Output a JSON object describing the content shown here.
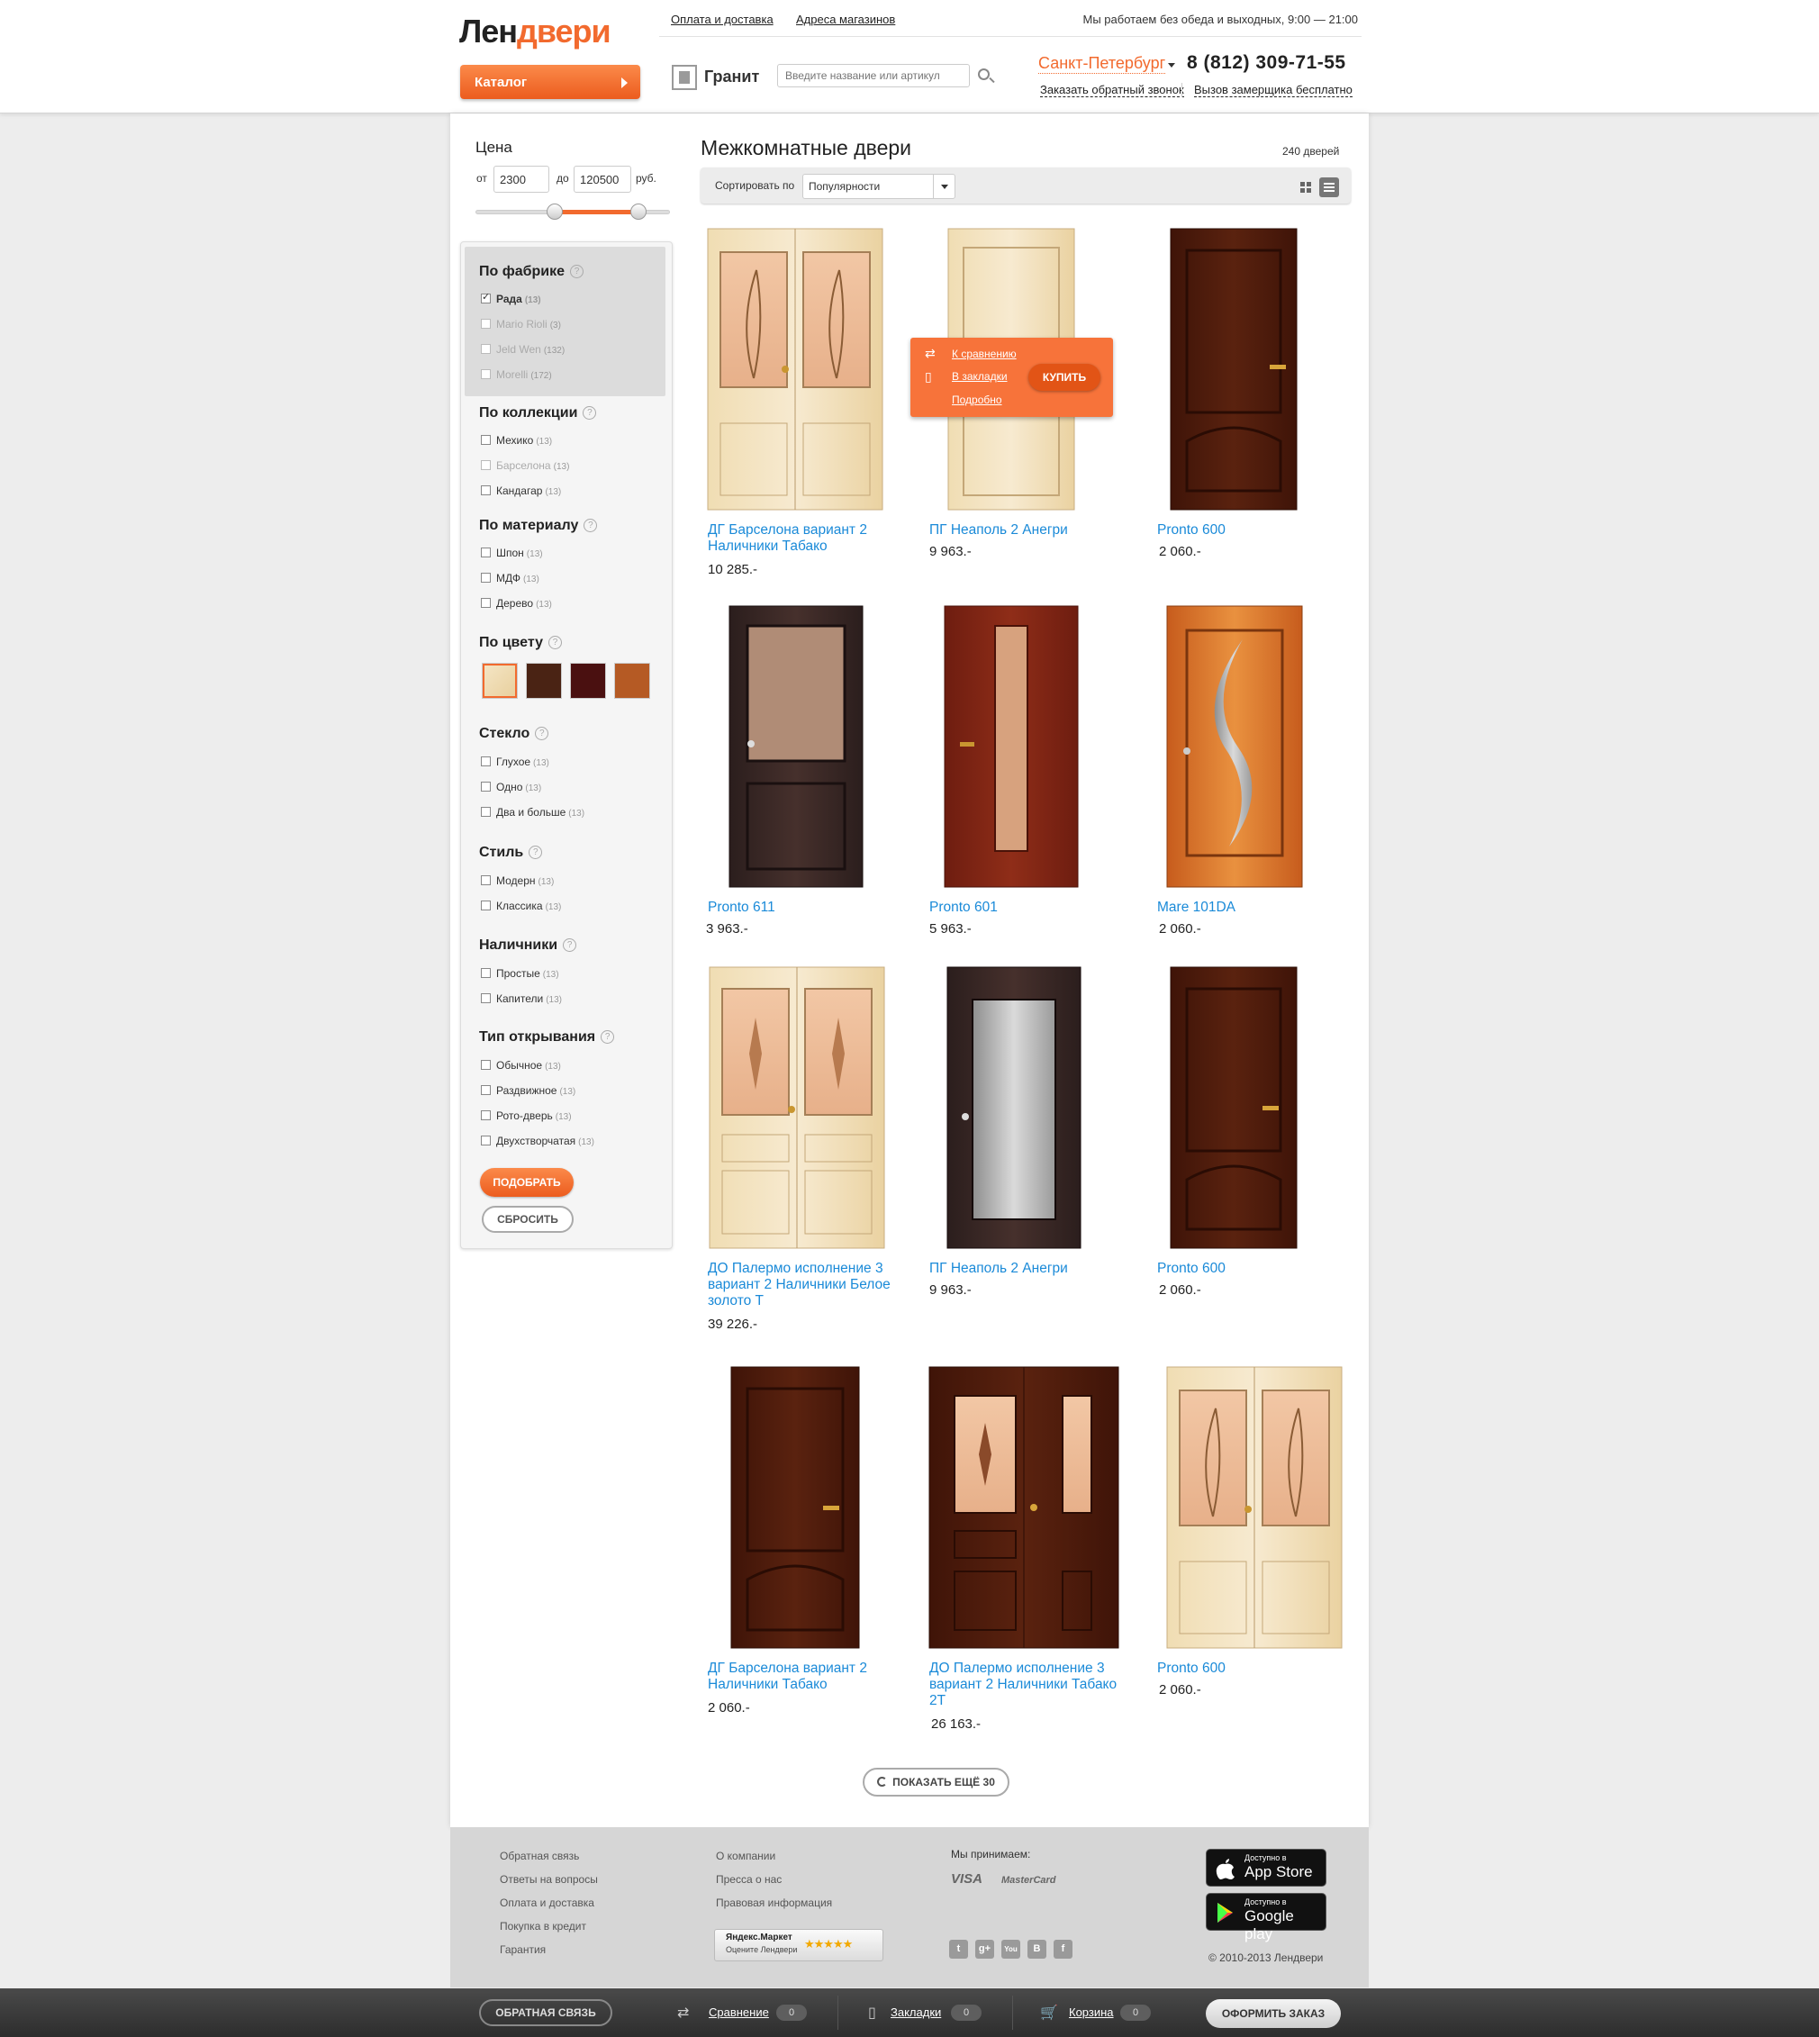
{
  "header": {
    "logo_part1": "Лен",
    "logo_part2": "двери",
    "catalog_label": "Каталог",
    "links": [
      "Оплата и доставка",
      "Адреса магазинов"
    ],
    "worktime": "Мы работаем без обеда и выходных, 9:00 — 21:00",
    "brand": "Гранит",
    "search_placeholder": "Введите название или артикул",
    "city": "Санкт-Петербург",
    "phone": "8 (812) 309-71-55",
    "callback": "Заказать обратный звонок",
    "measurer": "Вызов замерщика бесплатно"
  },
  "price_filter": {
    "title": "Цена",
    "from_label": "от",
    "from_value": "2300",
    "to_label": "до",
    "to_value": "120500",
    "currency": "руб."
  },
  "filters": {
    "factory": {
      "title": "По фабрике",
      "items": [
        {
          "label": "Рада",
          "count": "(13)"
        },
        {
          "label": "Mario Rioli",
          "count": "(3)"
        },
        {
          "label": "Jeld Wen",
          "count": "(132)"
        },
        {
          "label": "Morelli",
          "count": "(172)"
        }
      ]
    },
    "collection": {
      "title": "По коллекции",
      "items": [
        {
          "label": "Мехико",
          "count": "(13)"
        },
        {
          "label": "Барселона",
          "count": "(13)"
        },
        {
          "label": "Кандагар",
          "count": "(13)"
        }
      ]
    },
    "material": {
      "title": "По материалу",
      "items": [
        {
          "label": "Шпон",
          "count": "(13)"
        },
        {
          "label": "МДФ",
          "count": "(13)"
        },
        {
          "label": "Дерево",
          "count": "(13)"
        }
      ]
    },
    "color": {
      "title": "По цвету",
      "swatches": [
        "#f2dfb8",
        "#4a2314",
        "#4a1010",
        "#b55a24"
      ]
    },
    "glass": {
      "title": "Стекло",
      "items": [
        {
          "label": "Глухое",
          "count": "(13)"
        },
        {
          "label": "Одно",
          "count": "(13)"
        },
        {
          "label": "Два и больше",
          "count": "(13)"
        }
      ]
    },
    "style": {
      "title": "Стиль",
      "items": [
        {
          "label": "Модерн",
          "count": "(13)"
        },
        {
          "label": "Классика",
          "count": "(13)"
        }
      ]
    },
    "trim": {
      "title": "Наличники",
      "items": [
        {
          "label": "Простые",
          "count": "(13)"
        },
        {
          "label": "Капители",
          "count": "(13)"
        }
      ]
    },
    "opening": {
      "title": "Тип открывания",
      "items": [
        {
          "label": "Обычное",
          "count": "(13)"
        },
        {
          "label": "Раздвижное",
          "count": "(13)"
        },
        {
          "label": "Рото-дверь",
          "count": "(13)"
        },
        {
          "label": "Двухстворчатая",
          "count": "(13)"
        }
      ]
    },
    "apply_label": "ПОДОБРАТЬ",
    "reset_label": "СБРОСИТЬ"
  },
  "main": {
    "title": "Межкомнатные двери",
    "count": "240 дверей",
    "sort_label": "Сортировать по",
    "sort_value": "Популярности"
  },
  "hover_popup": {
    "compare": "К сравнению",
    "bookmark": "В закладки",
    "details": "Подробно",
    "buy": "КУПИТЬ"
  },
  "products": [
    {
      "name": "ДГ Барселона вариант 2 Наличники Табако",
      "price": "10 285.-"
    },
    {
      "name": "ПГ Неаполь 2 Анегри",
      "price": "9 963.-"
    },
    {
      "name": "Pronto 600",
      "price": "2 060.-"
    },
    {
      "name": "Pronto 611",
      "price": "3 963.-"
    },
    {
      "name": "Pronto 601",
      "price": "5 963.-"
    },
    {
      "name": "Mare 101DA",
      "price": "2 060.-"
    },
    {
      "name": "ДО Палермо исполнение 3 вариант 2 Наличники Белое золото Т",
      "price": "39 226.-"
    },
    {
      "name": "ПГ Неаполь 2 Анегри",
      "price": "9 963.-"
    },
    {
      "name": "Pronto 600",
      "price": "2 060.-"
    },
    {
      "name": "ДГ Барселона вариант 2 Наличники Табако",
      "price": "2 060.-"
    },
    {
      "name": "ДО Палермо исполнение 3 вариант 2 Наличники Табако 2Т",
      "price": "26 163.-"
    },
    {
      "name": "Pronto 600",
      "price": "2 060.-"
    }
  ],
  "load_more": "ПОКАЗАТЬ ЕЩЁ 30",
  "footer": {
    "col1": [
      "Обратная связь",
      "Ответы на вопросы",
      "Оплата и доставка",
      "Покупка в кредит",
      "Гарантия"
    ],
    "col2": [
      "О компании",
      "Пресса о нас",
      "Правовая информация"
    ],
    "accept": "Мы принимаем:",
    "cards": [
      "VISA",
      "MasterCard"
    ],
    "ym_title": "Яндекс.Маркет",
    "ym_sub": "Оцените Лендвери",
    "ym_stars": "★★★★★",
    "socials": [
      "twitter-icon",
      "google-plus-icon",
      "youtube-icon",
      "vk-icon",
      "facebook-icon"
    ],
    "appstore_l1": "Доступно в",
    "appstore_l2": "App Store",
    "gplay_l1": "Доступно в",
    "gplay_l2": "Google play",
    "copyright": "© 2010-2013 Лендвери"
  },
  "bottombar": {
    "feedback": "ОБРАТНАЯ СВЯЗЬ",
    "compare": "Сравнение",
    "compare_count": "0",
    "bookmarks": "Закладки",
    "bookmarks_count": "0",
    "cart": "Корзина",
    "cart_count": "0",
    "order": "ОФОРМИТЬ ЗАКАЗ"
  },
  "colors": {
    "accent": "#f26a2e",
    "link": "#1a8ad8"
  }
}
